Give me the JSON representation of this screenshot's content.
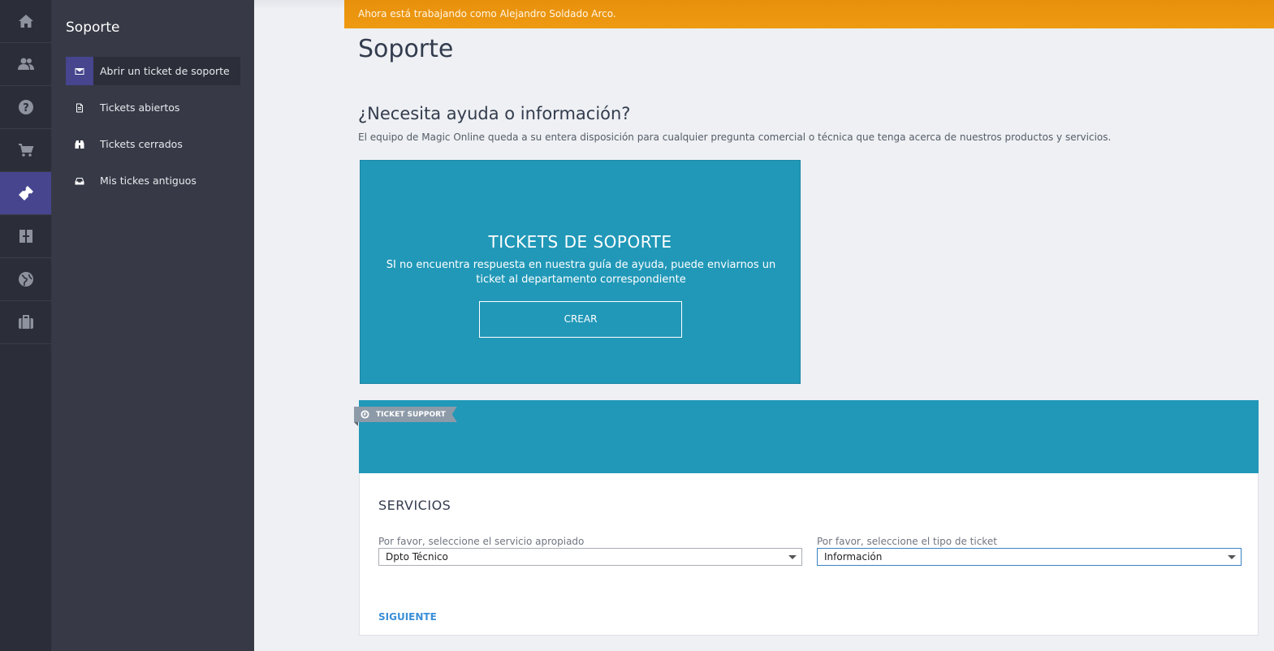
{
  "rail": {
    "items": [
      {
        "icon": "home-icon"
      },
      {
        "icon": "users-icon"
      },
      {
        "icon": "help-icon"
      },
      {
        "icon": "cart-icon"
      },
      {
        "icon": "ticket-icon",
        "active": true
      },
      {
        "icon": "domain-icon"
      },
      {
        "icon": "globe-icon"
      },
      {
        "icon": "briefcase-icon"
      }
    ]
  },
  "sidebar": {
    "title": "Soporte",
    "items": [
      {
        "label": "Abrir un ticket de soporte",
        "icon": "envelope-icon",
        "active": true
      },
      {
        "label": "Tickets abiertos",
        "icon": "document-icon"
      },
      {
        "label": "Tickets cerrados",
        "icon": "binoculars-icon"
      },
      {
        "label": "Mis tickes antiguos",
        "icon": "inbox-icon"
      }
    ]
  },
  "notice": "Ahora está trabajando como Alejandro Soldado Arco.",
  "page_title": "Soporte",
  "help": {
    "title": "¿Necesita ayuda o información?",
    "description": "El equipo de Magic Online queda a su entera disposición para cualquier pregunta comercial o técnica que tenga acerca de nuestros productos y servicios."
  },
  "card": {
    "title": "TICKETS DE SOPORTE",
    "description": "SI no encuentra respuesta en nuestra guía de ayuda, puede enviarnos un ticket al departamento correspondiente",
    "button": "CREAR"
  },
  "panel": {
    "ribbon": "TICKET SUPPORT",
    "title": "SERVICIOS",
    "service_label": "Por favor, seleccione el servicio apropiado",
    "service_value": "Dpto Técnico",
    "type_label": "Por favor, seleccione el tipo de ticket",
    "type_value": "Información",
    "next": "SIGUIENTE"
  },
  "colors": {
    "accent": "#46458e",
    "card": "#2198b8",
    "notice": "#ef9a12",
    "link": "#3a8fd8"
  }
}
